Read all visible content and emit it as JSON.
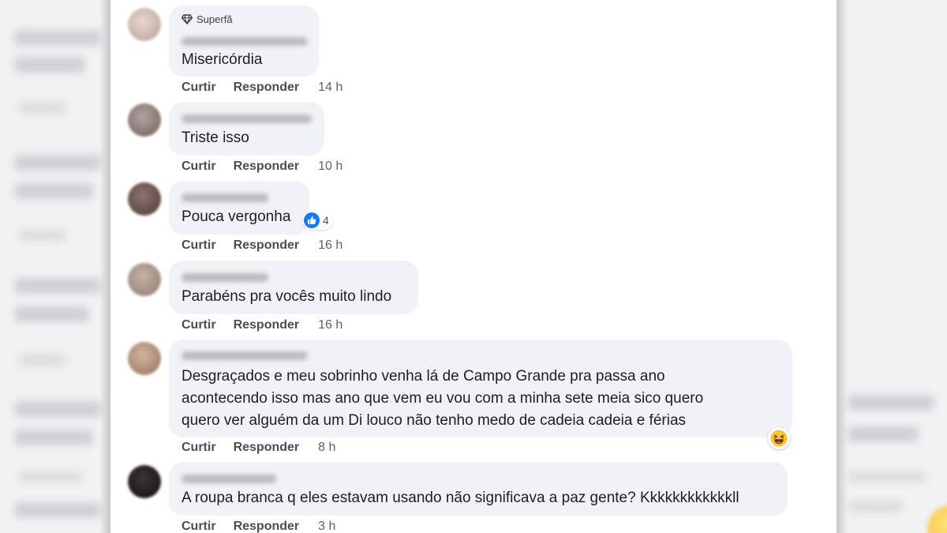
{
  "colors": {
    "bubble": "#f0f2f5",
    "like_blue": "#1877f2",
    "action_text": "#4a4d52",
    "page": "#ffffff"
  },
  "comments": [
    {
      "badge": "Superfã",
      "badge_icon": "diamond-icon",
      "text": "Misericórdia",
      "like": "Curtir",
      "reply": "Responder",
      "time": "14 h"
    },
    {
      "text": "Triste isso",
      "like": "Curtir",
      "reply": "Responder",
      "time": "10 h"
    },
    {
      "text": "Pouca vergonha",
      "reaction_icon": "like-icon",
      "reaction_count": "4",
      "like": "Curtir",
      "reply": "Responder",
      "time": "16 h"
    },
    {
      "text": "Parabéns pra vocês muito lindo",
      "like": "Curtir",
      "reply": "Responder",
      "time": "16 h"
    },
    {
      "text_lines": [
        "Desgraçados e meu sobrinho venha lá de Campo Grande pra passa ano",
        "acontecendo isso mas ano que vem eu vou com a minha sete meia sico quero",
        "quero ver alguém da um Di louco não tenho medo de cadeia cadeia e férias"
      ],
      "reaction_icon": "haha-icon",
      "like": "Curtir",
      "reply": "Responder",
      "time": "8 h"
    },
    {
      "text": "A roupa branca q eles estavam usando não significava a paz gente? Kkkkkkkkkkkkll",
      "like": "Curtir",
      "reply": "Responder",
      "time": "3 h"
    }
  ]
}
